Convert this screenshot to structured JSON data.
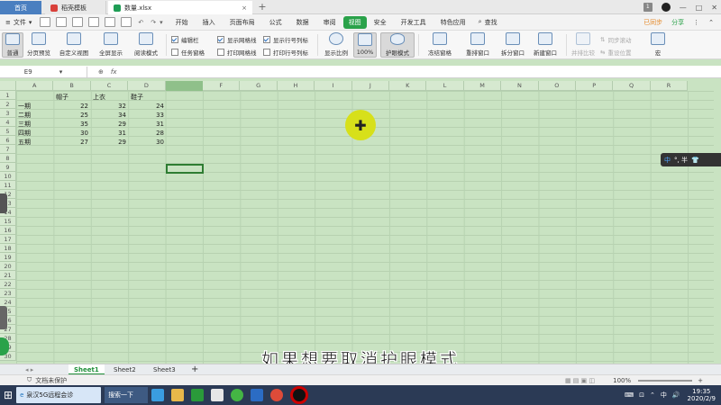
{
  "titlebar": {
    "tabs": [
      {
        "label": "首页",
        "active": true
      },
      {
        "label": "稻壳模板"
      },
      {
        "label": "数量.xlsx"
      }
    ],
    "badge": "1"
  },
  "menubar": {
    "file_label": "文件",
    "items": [
      "开始",
      "插入",
      "页面布局",
      "公式",
      "数据",
      "审阅",
      "视图",
      "安全",
      "开发工具",
      "特色应用"
    ],
    "active_item": "视图",
    "search_label": "查找",
    "right_items": [
      "已同步",
      "分享"
    ]
  },
  "ribbon": {
    "buttons": [
      "普通",
      "分页预览",
      "自定义视图",
      "全屏显示",
      "阅读模式",
      "显示比例",
      "100%",
      "护眼模式",
      "冻结窗格",
      "重排窗口",
      "拆分窗口",
      "新建窗口",
      "并排比较",
      "同步滚动",
      "重设位置",
      "宏"
    ],
    "checks_row1": [
      {
        "label": "编辑栏",
        "checked": true
      },
      {
        "label": "显示网格线",
        "checked": true
      },
      {
        "label": "显示行号列标",
        "checked": true
      }
    ],
    "checks_row2": [
      {
        "label": "任务窗格",
        "checked": false
      },
      {
        "label": "打印网格线",
        "checked": false
      },
      {
        "label": "打印行号列标",
        "checked": false
      }
    ]
  },
  "formula_bar": {
    "cell_ref": "E9",
    "fx_label": "fx"
  },
  "sheet": {
    "columns": [
      "A",
      "B",
      "C",
      "D",
      "E",
      "F",
      "G",
      "H",
      "I",
      "J",
      "K",
      "L",
      "M",
      "N",
      "O",
      "P",
      "Q",
      "R"
    ],
    "rows": [
      "1",
      "2",
      "3",
      "4",
      "5",
      "6",
      "7",
      "8",
      "9",
      "10",
      "11",
      "12",
      "13",
      "14",
      "15",
      "16",
      "17",
      "18",
      "19",
      "20",
      "21",
      "22",
      "23",
      "24",
      "25",
      "26",
      "27",
      "28",
      "29",
      "30"
    ],
    "headers": [
      "帽子",
      "上衣",
      "鞋子"
    ],
    "data": [
      {
        "period": "一期",
        "values": [
          "22",
          "32",
          "24"
        ]
      },
      {
        "period": "二期",
        "values": [
          "25",
          "34",
          "33"
        ]
      },
      {
        "period": "三期",
        "values": [
          "35",
          "29",
          "31"
        ]
      },
      {
        "period": "四期",
        "values": [
          "30",
          "31",
          "28"
        ]
      },
      {
        "period": "五期",
        "values": [
          "27",
          "29",
          "30"
        ]
      }
    ],
    "selected_cell": "E9"
  },
  "ime": {
    "label_blue": "中",
    "label_rest": "°, 半"
  },
  "sheet_tabs": [
    "Sheet1",
    "Sheet2",
    "Sheet3"
  ],
  "active_sheet": "Sheet1",
  "statusbar": {
    "protect": "文档未保护",
    "zoom": "100%"
  },
  "caption": "如果想要取消护眼模式",
  "taskbar": {
    "window_title": "泉汉5G远程会诊",
    "search": "搜索一下",
    "ime": "中",
    "time": "19:35",
    "date": "2020/2/9"
  },
  "colors": {
    "eye_mode_bg": "#c9e3c2",
    "accent_green": "#2aa24a",
    "taskbar": "#2b3a55"
  }
}
